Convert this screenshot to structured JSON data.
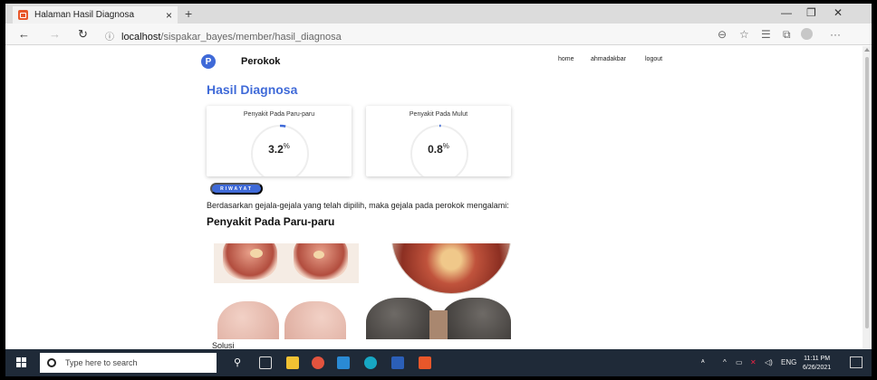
{
  "browser": {
    "tab_title": "Halaman Hasil Diagnosa",
    "tab_close": "×",
    "new_tab": "+",
    "url_host": "localhost",
    "url_path": "/sispakar_bayes/member/hasil_diagnosa",
    "info_icon": "ⓘ",
    "window_min": "—",
    "window_max": "❐",
    "window_close": "✕",
    "back": "←",
    "forward": "→",
    "refresh": "↻",
    "more": "···"
  },
  "navbar": {
    "logo_letter": "P",
    "brand": "Perokok",
    "menu": [
      {
        "label": "home"
      },
      {
        "label": "ahmadakbar"
      },
      {
        "label": "logout"
      }
    ]
  },
  "page": {
    "title": "Hasil Diagnosa",
    "cards": [
      {
        "title": "Penyakit Pada Paru-paru",
        "value": "3.2",
        "unit": "%",
        "fraction": 0.032
      },
      {
        "title": "Penyakit Pada Mulut",
        "value": "0.8",
        "unit": "%",
        "fraction": 0.008
      }
    ],
    "riwayat_button": "RIWAYAT",
    "description": "Berdasarkan gejala-gejala yang telah dipilih, maka gejala pada perokok mengalami:",
    "disease_title": "Penyakit Pada Paru-paru",
    "solusi_label": "Solusi"
  },
  "taskbar": {
    "search_placeholder": "Type here to search",
    "lang": "ENG",
    "time": "11:11 PM",
    "date": "6/26/2021"
  },
  "colors": {
    "accent": "#3f6ad8",
    "taskbar": "#1f2a38"
  }
}
